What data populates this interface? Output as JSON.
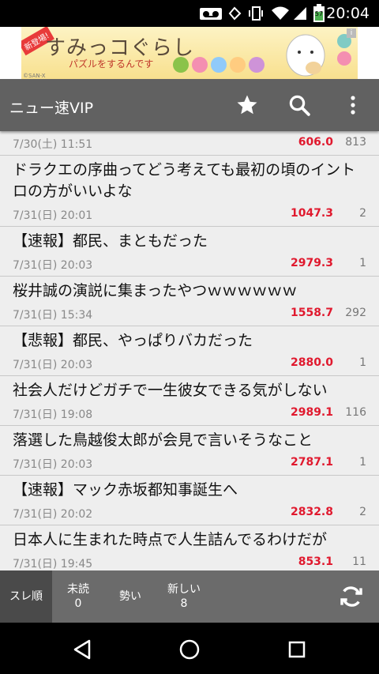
{
  "status": {
    "time": "20:04",
    "battery": "57"
  },
  "ad": {
    "tag": "新登場!",
    "title": "すみっコぐらし",
    "subtitle": "パズルをするんです",
    "credit": "©SAN-X",
    "info": "i"
  },
  "app_bar": {
    "title": "ニュー速VIP",
    "icons": [
      "star-icon",
      "search-icon",
      "more-vertical-icon"
    ]
  },
  "threads": [
    {
      "title": "",
      "date": "7/30(土) 11:51",
      "ikioi": "606.0",
      "count": "813"
    },
    {
      "title": "ドラクエの序曲ってどう考えても最初の頃のイントロの方がいいよな",
      "date": "7/31(日) 20:01",
      "ikioi": "1047.3",
      "count": "2"
    },
    {
      "title": "【速報】都民、まともだった",
      "date": "7/31(日) 20:03",
      "ikioi": "2979.3",
      "count": "1"
    },
    {
      "title": "桜井誠の演説に集まったやつｗｗｗｗｗｗ",
      "date": "7/31(日) 15:34",
      "ikioi": "1558.7",
      "count": "292"
    },
    {
      "title": "【悲報】都民、やっぱりバカだった",
      "date": "7/31(日) 20:03",
      "ikioi": "2880.0",
      "count": "1"
    },
    {
      "title": "社会人だけどガチで一生彼女できる気がしない",
      "date": "7/31(日) 19:08",
      "ikioi": "2989.1",
      "count": "116"
    },
    {
      "title": "落選した鳥越俊太郎が会見で言いそうなこと",
      "date": "7/31(日) 20:03",
      "ikioi": "2787.1",
      "count": "1"
    },
    {
      "title": "【速報】マック赤坂都知事誕生へ",
      "date": "7/31(日) 20:02",
      "ikioi": "2832.8",
      "count": "2"
    },
    {
      "title": "日本人に生まれた時点で人生詰んでるわけだが",
      "date": "7/31(日) 19:45",
      "ikioi": "853.1",
      "count": "11"
    }
  ],
  "tabs": {
    "sort": "スレ順",
    "unread_label": "未読",
    "unread_count": "0",
    "momentum": "勢い",
    "new_label": "新しい",
    "new_count": "8"
  },
  "colors": {
    "app_bar": "#616161",
    "ikioi": "#e0192e",
    "tabs": "#6b6b6b",
    "active_tab": "#4a4a4a"
  }
}
